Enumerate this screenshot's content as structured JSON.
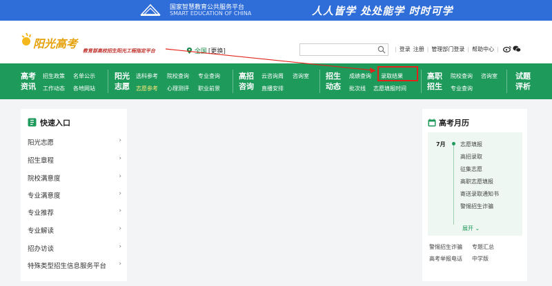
{
  "topband": {
    "platform_cn": "国家智慧教育公共服务平台",
    "platform_en": "SMART EDUCATION OF CHINA",
    "slogan": "人人皆学 处处能学 时时可学",
    "color": "#2f6dd8"
  },
  "header": {
    "brand_name": "阳光高考",
    "brand_tag": "教育部高校招生阳光工程指定平台",
    "region": "全国",
    "region_switch": "[更换]",
    "search_value": "",
    "links": [
      "登录",
      "注册",
      "管理部门登录",
      "帮助中心"
    ],
    "icons": [
      "weibo-icon",
      "wechat-icon"
    ]
  },
  "nav": {
    "color": "#1e9a5b",
    "groups": [
      {
        "head": "高考资讯",
        "links": [
          "招生政策",
          "名单公示",
          "工作动态",
          "各地网站"
        ]
      },
      {
        "head": "阳光志愿",
        "links": [
          "选科参考",
          "院校查询",
          "专业查询",
          "志愿参考",
          "心理测评",
          "职业前景"
        ]
      },
      {
        "head": "高招咨询",
        "links": [
          "云咨询周",
          "咨询室",
          "直播安排"
        ]
      },
      {
        "head": "招生动态",
        "links": [
          "成绩查询",
          "录取结果",
          "批次线",
          "志愿填报时间"
        ]
      },
      {
        "head": "高职招生",
        "links": [
          "院校查询",
          "咨询室",
          "专业查询"
        ]
      },
      {
        "head": "试题评析",
        "links": []
      }
    ]
  },
  "quick_entry": {
    "title": "快速入口",
    "items": [
      "阳光志愿",
      "招生章程",
      "院校满意度",
      "专业满意度",
      "专业推荐",
      "专业解读",
      "招办访谈",
      "特殊类型招生信息服务平台"
    ]
  },
  "calendar": {
    "title": "高考月历",
    "month": "7月",
    "events": [
      "志愿填报",
      "高招录取",
      "征集志愿",
      "高职志愿填报",
      "寄送录取通知书",
      "警惕招生诈骗"
    ],
    "more": "展开",
    "links_row1": [
      "警惕招生诈骗",
      "专题汇总"
    ],
    "links_row2": [
      "高考举报电话",
      "中学版"
    ]
  }
}
